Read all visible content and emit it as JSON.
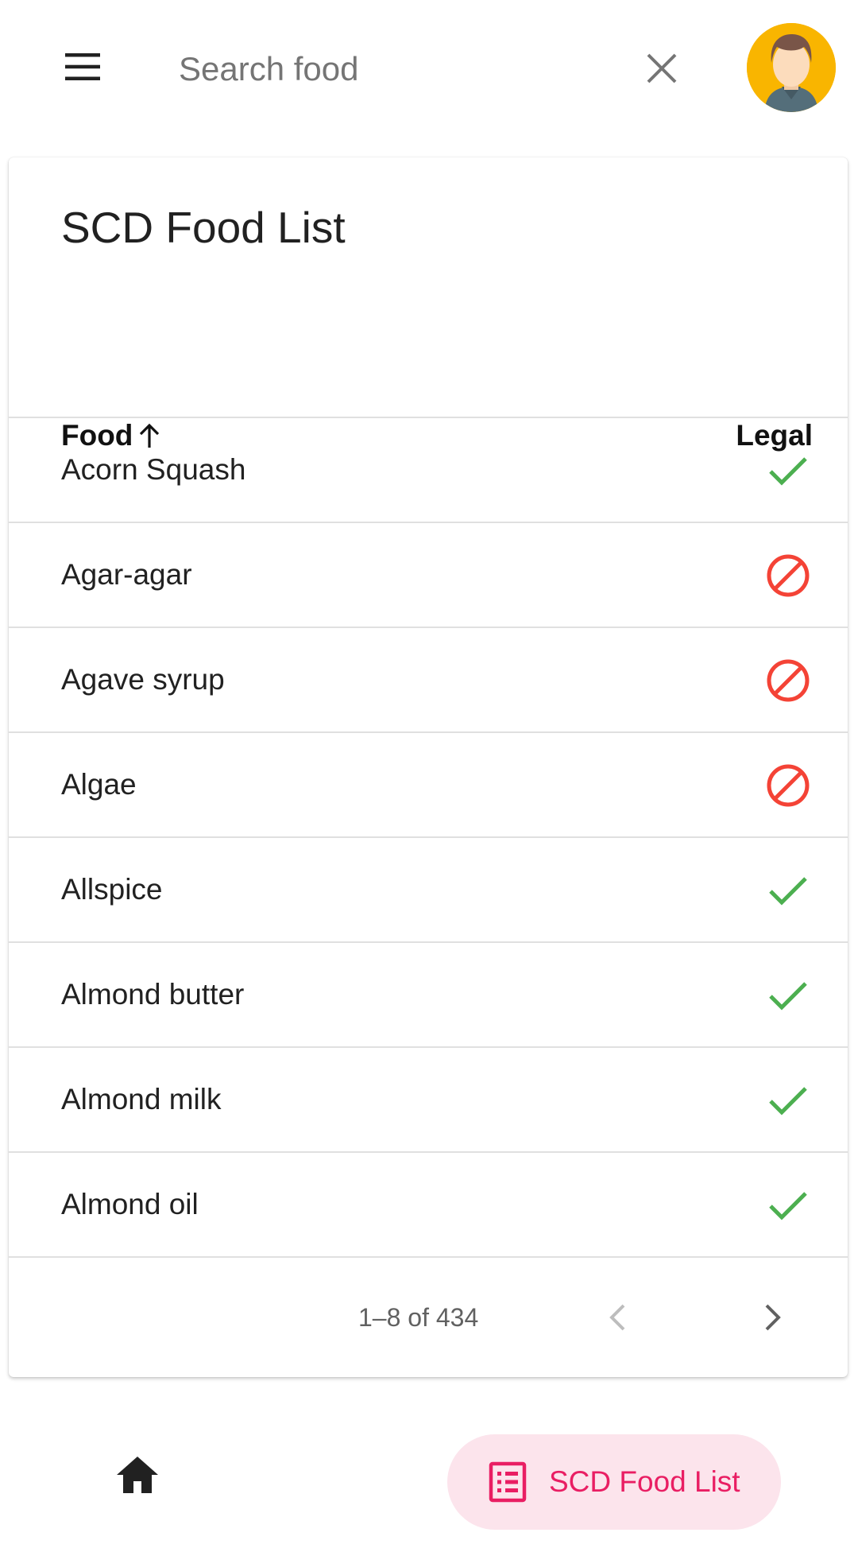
{
  "search": {
    "placeholder": "Search food",
    "value": ""
  },
  "card": {
    "title": "SCD Food List"
  },
  "table": {
    "columns": {
      "food": "Food",
      "legal": "Legal"
    },
    "sort": {
      "column": "food",
      "direction": "ascending",
      "icon": "arrow-up-icon"
    },
    "rows": [
      {
        "name": "Acorn Squash",
        "legal": true
      },
      {
        "name": "Agar-agar",
        "legal": false
      },
      {
        "name": "Agave syrup",
        "legal": false
      },
      {
        "name": "Algae",
        "legal": false
      },
      {
        "name": "Allspice",
        "legal": true
      },
      {
        "name": "Almond butter",
        "legal": true
      },
      {
        "name": "Almond milk",
        "legal": true
      },
      {
        "name": "Almond oil",
        "legal": true
      }
    ]
  },
  "pagination": {
    "range": "1–8 of 434",
    "prev_enabled": false,
    "next_enabled": true
  },
  "bottom_nav": {
    "home_icon": "home-icon",
    "active_label": "SCD Food List",
    "active_icon": "list-icon"
  },
  "colors": {
    "legal": "#4caf50",
    "not_legal": "#f44336",
    "accent": "#e91e63",
    "accent_bg": "#fce4ec",
    "divider": "#e0e0e0",
    "avatar_bg": "#f9b500"
  }
}
